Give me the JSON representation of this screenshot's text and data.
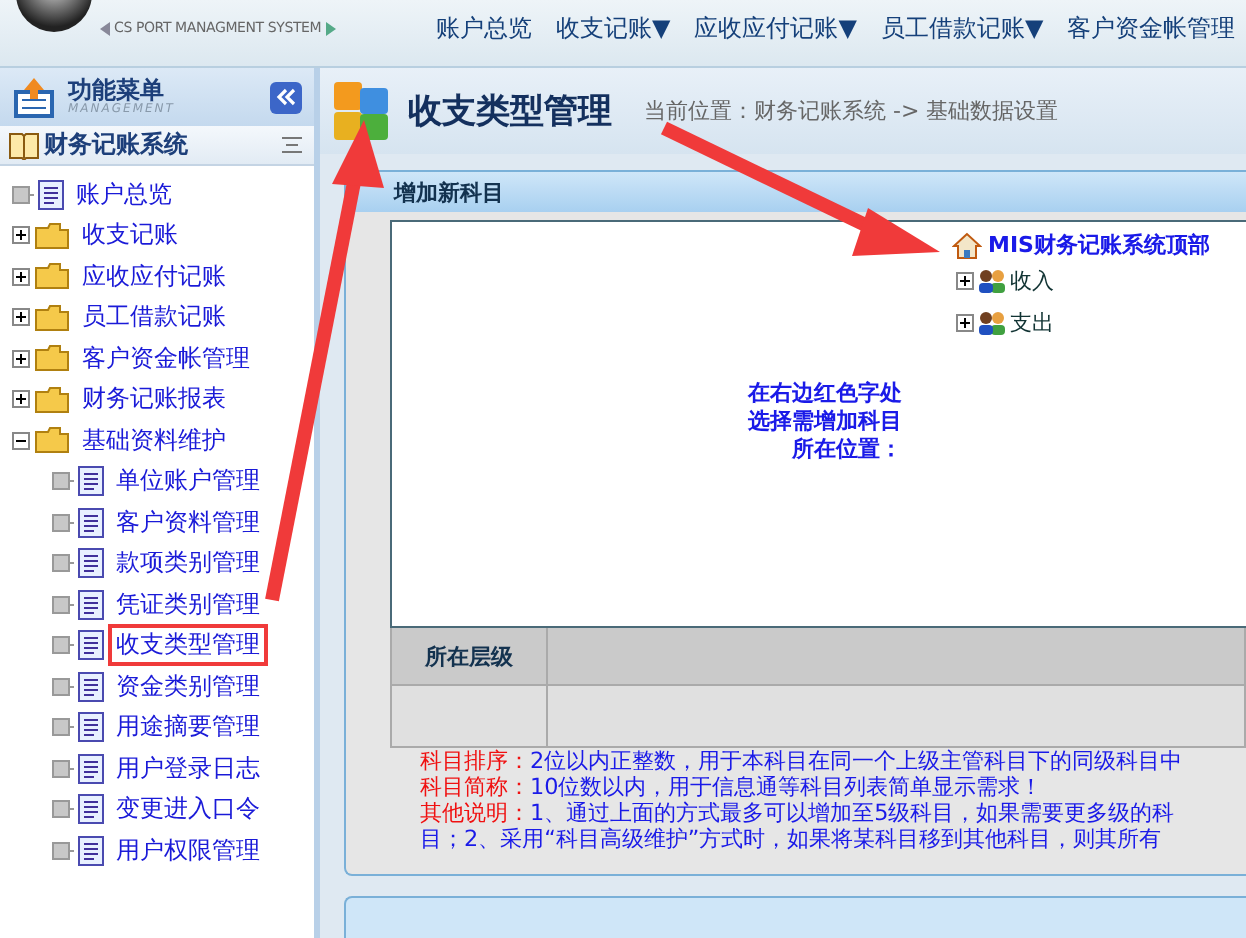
{
  "header": {
    "subtitle": "CS PORT MANAGMENT SYSTEM",
    "nav": [
      "账户总览",
      "收支记账▼",
      "应收应付记账▼",
      "员工借款记账▼",
      "客户资金帐管理"
    ]
  },
  "sidebar": {
    "title": "功能菜单",
    "title_sub": "MANAGEMENT",
    "system": "财务记账系统",
    "tree": [
      {
        "label": "账户总览",
        "kind": "page",
        "selected": false
      },
      {
        "label": "收支记账",
        "kind": "folder",
        "expanded": false,
        "selected": false
      },
      {
        "label": "应收应付记账",
        "kind": "folder",
        "expanded": false,
        "selected": false
      },
      {
        "label": "员工借款记账",
        "kind": "folder",
        "expanded": false,
        "selected": false
      },
      {
        "label": "客户资金帐管理",
        "kind": "folder",
        "expanded": false,
        "selected": false
      },
      {
        "label": "财务记账报表",
        "kind": "folder",
        "expanded": false,
        "selected": false
      },
      {
        "label": "基础资料维护",
        "kind": "folder",
        "expanded": true,
        "selected": false,
        "children": [
          {
            "label": "单位账户管理",
            "kind": "page",
            "selected": false
          },
          {
            "label": "客户资料管理",
            "kind": "page",
            "selected": false
          },
          {
            "label": "款项类别管理",
            "kind": "page",
            "selected": false
          },
          {
            "label": "凭证类别管理",
            "kind": "page",
            "selected": false
          },
          {
            "label": "收支类型管理",
            "kind": "page",
            "selected": true
          },
          {
            "label": "资金类别管理",
            "kind": "page",
            "selected": false
          },
          {
            "label": "用途摘要管理",
            "kind": "page",
            "selected": false
          },
          {
            "label": "用户登录日志",
            "kind": "page",
            "selected": false
          },
          {
            "label": "变更进入口令",
            "kind": "page",
            "selected": false
          },
          {
            "label": "用户权限管理",
            "kind": "page",
            "selected": false
          }
        ]
      }
    ]
  },
  "page": {
    "title": "收支类型管理",
    "breadcrumb": "当前位置：财务记账系统 -> 基础数据设置"
  },
  "panel": {
    "title": "增加新科目",
    "category_tree": {
      "label": "MIS财务记账系统顶部",
      "children": [
        {
          "label": "收入",
          "expanded": false
        },
        {
          "label": "支出",
          "expanded": false
        }
      ]
    },
    "hint_lines": [
      "在右边红色字处",
      "选择需增加科目",
      "所在位置："
    ],
    "table": {
      "columns": [
        "所在层级"
      ]
    },
    "notes": [
      {
        "label": "科目排序：",
        "text": "2位以内正整数，用于本科目在同一个上级主管科目下的同级科目中"
      },
      {
        "label": "科目简称：",
        "text": "10位数以内，用于信息通等科目列表简单显示需求！"
      },
      {
        "label": "其他说明：",
        "text": "1、通过上面的方式最多可以增加至5级科目，如果需要更多级的科"
      },
      {
        "text": "目；2、采用“科目高级维护”方式时，如果将某科目移到其他科目，则其所有"
      }
    ]
  }
}
